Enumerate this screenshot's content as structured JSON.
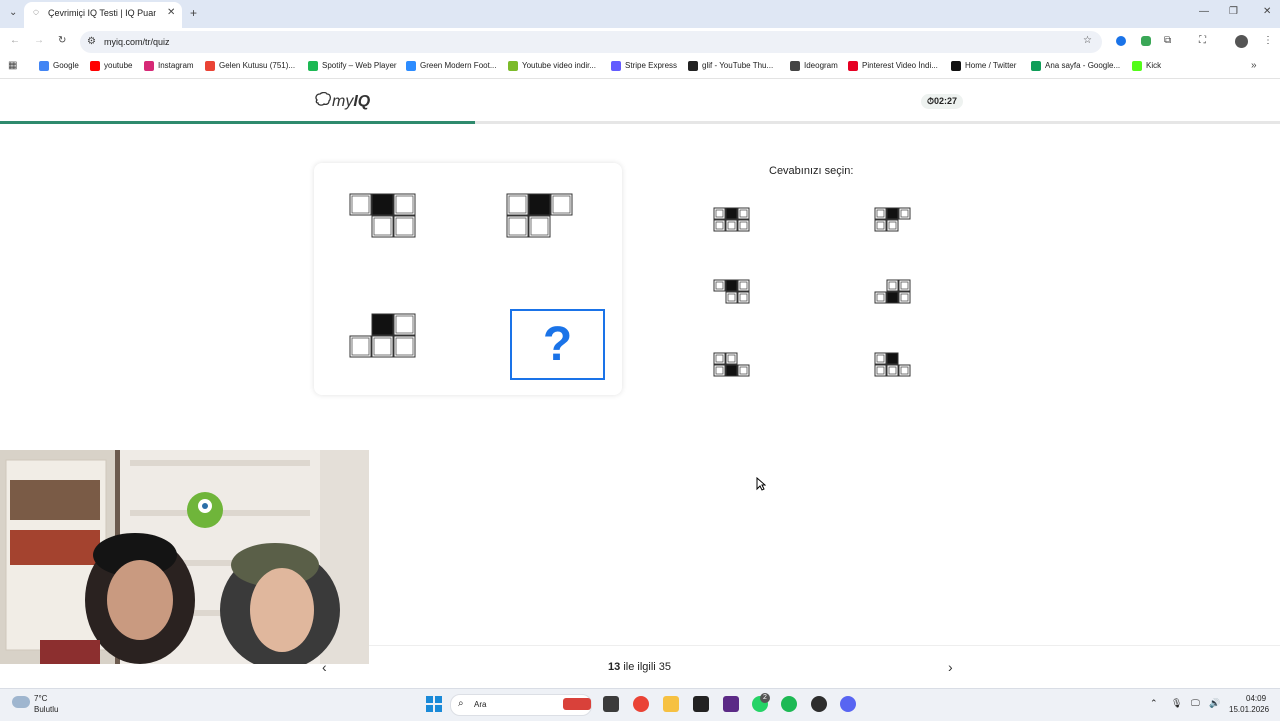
{
  "browser": {
    "tab_title": "Çevrimiçi IQ Testi | IQ Puanınızı",
    "url": "myiq.com/tr/quiz",
    "bookmarks": [
      {
        "label": "Google",
        "color": "#4285f4"
      },
      {
        "label": "youtube",
        "color": "#ff0000"
      },
      {
        "label": "Instagram",
        "color": "#d62976"
      },
      {
        "label": "Gelen Kutusu (751)...",
        "color": "#ea4335"
      },
      {
        "label": "Spotify – Web Player",
        "color": "#1db954"
      },
      {
        "label": "Green Modern Foot...",
        "color": "#2d8cff"
      },
      {
        "label": "Youtube video indir...",
        "color": "#7cbb2a"
      },
      {
        "label": "Stripe Express",
        "color": "#635bff"
      },
      {
        "label": "glif - YouTube Thu...",
        "color": "#222222"
      },
      {
        "label": "Ideogram",
        "color": "#444444"
      },
      {
        "label": "Pinterest Video İndi...",
        "color": "#e60023"
      },
      {
        "label": "Home / Twitter",
        "color": "#111111"
      },
      {
        "label": "Ana sayfa - Google...",
        "color": "#0f9d58"
      },
      {
        "label": "Kick",
        "color": "#53fc18"
      }
    ]
  },
  "header": {
    "logo_my": "my",
    "logo_iq": "IQ",
    "timer": "02:27",
    "progress_fraction": 0.371
  },
  "puzzle": {
    "question_mark": "?",
    "choose_label": "Cevabınızı seçin:"
  },
  "pager": {
    "current": "13",
    "separator": "ile ilgili",
    "total": "35"
  },
  "taskbar": {
    "weather_temp": "7°C",
    "weather_desc": "Bulutlu",
    "search_label": "Ara",
    "time": "04:09",
    "date": "15.01.2026",
    "whatsapp_badge": "2"
  },
  "colors": {
    "accent": "#1a73e8",
    "progress": "#2f8a6d"
  }
}
